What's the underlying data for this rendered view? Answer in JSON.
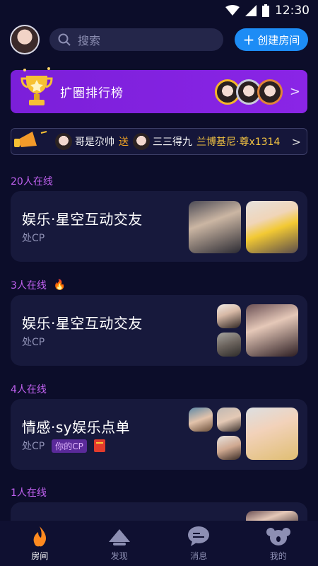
{
  "status": {
    "time": "12:30"
  },
  "header": {
    "search_placeholder": "搜索",
    "create_label": "创建房间"
  },
  "rank_banner": {
    "title": "扩圈排行榜"
  },
  "gift_bar": {
    "sender": "哥是尕帅",
    "action": "送",
    "receiver": "三三得九",
    "gift": "兰博基尼·尊x1314"
  },
  "sections": [
    {
      "count": "20人在线",
      "title": "娱乐·星空互动交友",
      "sub": "处CP"
    },
    {
      "count": "3人在线",
      "title": "娱乐·星空互动交友",
      "sub": "处CP"
    },
    {
      "count": "4人在线",
      "title": "情感·sy娱乐点单",
      "sub": "处CP",
      "tag": "你的CP"
    },
    {
      "count": "1人在线"
    }
  ],
  "tabs": [
    {
      "label": "房间"
    },
    {
      "label": "发现"
    },
    {
      "label": "消息"
    },
    {
      "label": "我的"
    }
  ],
  "colors": {
    "accent": "#1d8cf5",
    "banner": "#8a25e6",
    "background": "#0c0d2a",
    "count": "#c061f0"
  }
}
